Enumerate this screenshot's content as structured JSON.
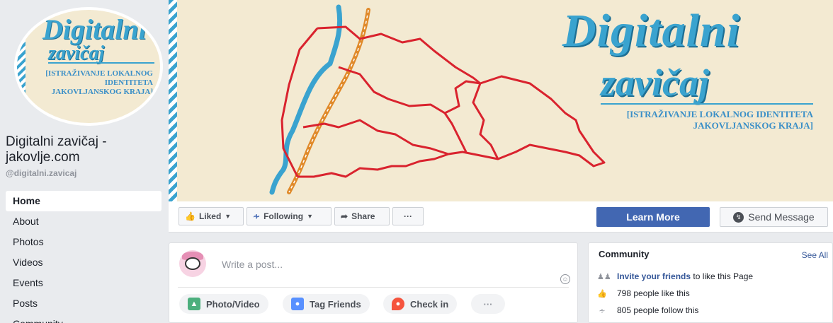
{
  "sidebar": {
    "avatar_title_line1": "Digitalni",
    "avatar_title_line2": "zavičaj",
    "avatar_subtitle": "[ISTRAŽIVANJE LOKALNOG IDENTITETA JAKOVLJANSKOG KRAJA]",
    "page_name": "Digitalni zavičaj - jakovlje.com",
    "handle": "@digitalni.zavicaj",
    "nav": [
      "Home",
      "About",
      "Photos",
      "Videos",
      "Events",
      "Posts",
      "Community"
    ]
  },
  "cover": {
    "title_line1": "Digitalni",
    "title_line2": "zavičaj",
    "subtitle": "[ISTRAŽIVANJE LOKALNOG IDENTITETA JAKOVLJANSKOG KRAJA]"
  },
  "actionbar": {
    "liked_label": "Liked",
    "following_label": "Following",
    "share_label": "Share",
    "more_label": "···",
    "learn_more_label": "Learn More",
    "send_message_label": "Send Message"
  },
  "composer": {
    "placeholder": "Write a post...",
    "photo_video_label": "Photo/Video",
    "tag_friends_label": "Tag Friends",
    "check_in_label": "Check in",
    "more_label": "···"
  },
  "community": {
    "title": "Community",
    "see_all": "See All",
    "invite_link": "Invite your friends",
    "invite_rest": " to like this Page",
    "likes_text": "798 people like this",
    "follows_text": "805 people follow this"
  },
  "colors": {
    "brand_blue": "#4267b2",
    "cover_accent": "#3aa3cf",
    "map_border": "#d9232e",
    "road": "#e08a2a"
  }
}
